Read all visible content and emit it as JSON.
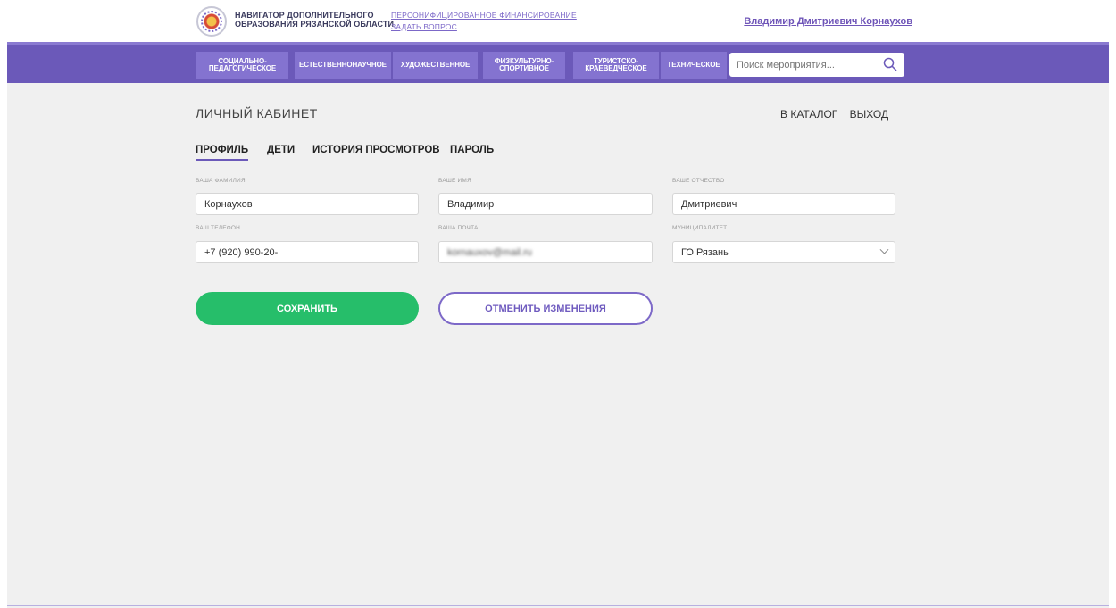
{
  "header": {
    "brand_line1": "Навигатор дополнительного",
    "brand_line2": "образования Рязанской области",
    "link_financing": "Персонифицированное финансирование",
    "link_question": "Задать вопрос",
    "user_name": "Владимир Дмитриевич Корнаухов"
  },
  "nav": {
    "items": [
      {
        "label": "Социально-педагогическое"
      },
      {
        "label": "Естественнонаучное"
      },
      {
        "label": "Художественное"
      },
      {
        "label": "Физкультурно-спортивное"
      },
      {
        "label": "Туристско-краеведческое"
      },
      {
        "label": "Техническое"
      }
    ],
    "search_placeholder": "Поиск мероприятия..."
  },
  "page": {
    "title": "ЛИЧНЫЙ КАБИНЕТ",
    "link_catalog": "В КАТАЛОГ",
    "link_logout": "ВЫХОД"
  },
  "tabs": [
    {
      "label": "ПРОФИЛЬ",
      "active": true
    },
    {
      "label": "ДЕТИ",
      "active": false
    },
    {
      "label": "ИСТОРИЯ ПРОСМОТРОВ",
      "active": false
    },
    {
      "label": "ПАРОЛЬ",
      "active": false
    }
  ],
  "form": {
    "surname": {
      "label": "Ваша фамилия",
      "value": "Корнаухов"
    },
    "name": {
      "label": "Ваше имя",
      "value": "Владимир"
    },
    "patronymic": {
      "label": "Ваше отчество",
      "value": "Дмитриевич"
    },
    "phone": {
      "label": "Ваш телефон",
      "value": "+7 (920) 990-20-"
    },
    "email": {
      "label": "Ваша почта",
      "value": "kornauxov@mail.ru"
    },
    "municipality": {
      "label": "Муниципалитет",
      "value": "ГО Рязань"
    }
  },
  "actions": {
    "save": "СОХРАНИТЬ",
    "cancel": "ОТМЕНИТЬ ИЗМЕНЕНИЯ"
  },
  "colors": {
    "brand_purple": "#6b59b9",
    "save_green": "#26be6a"
  }
}
